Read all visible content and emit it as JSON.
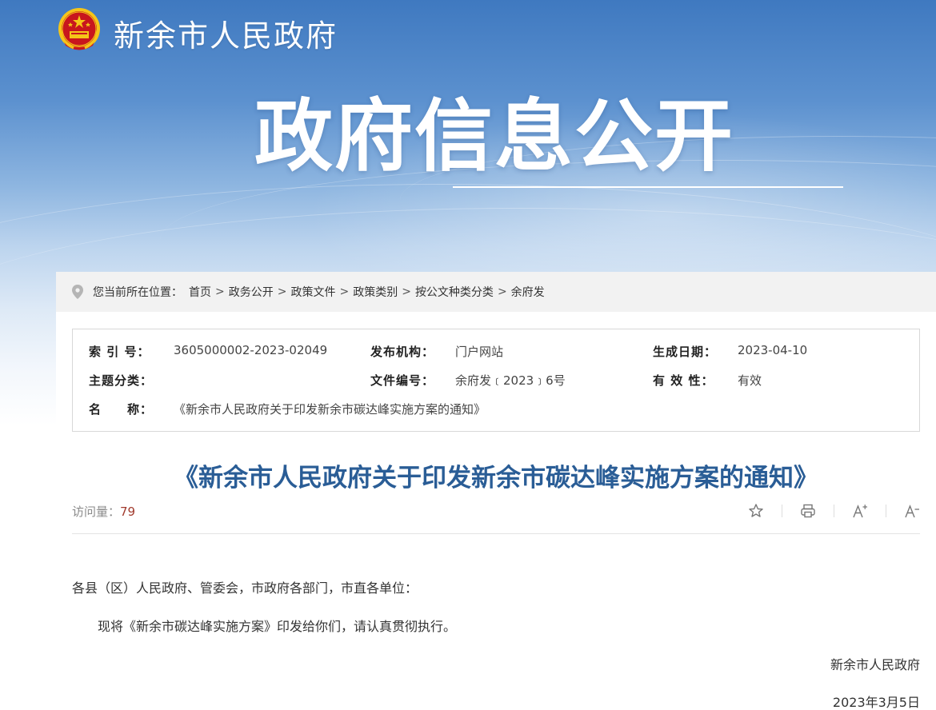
{
  "header": {
    "site_title": "新余市人民政府",
    "hero_title": "政府信息公开"
  },
  "breadcrumb": {
    "prefix": "您当前所在位置：",
    "items": [
      "首页",
      "政务公开",
      "政策文件",
      "政策类别",
      "按公文种类分类",
      "余府发"
    ],
    "separator": ">"
  },
  "info": {
    "index_label": "索 引 号：",
    "index_value": "3605000002-2023-02049",
    "publisher_label": "发布机构：",
    "publisher_value": "门户网站",
    "date_label": "生成日期：",
    "date_value": "2023-04-10",
    "topic_label": "主题分类：",
    "topic_value": "",
    "docno_label": "文件编号：",
    "docno_value": "余府发﹝2023﹞6号",
    "validity_label": "有 效 性：",
    "validity_value": "有效",
    "name_label": "名　　称：",
    "name_value": "《新余市人民政府关于印发新余市碳达峰实施方案的通知》"
  },
  "document": {
    "title": "《新余市人民政府关于印发新余市碳达峰实施方案的通知》",
    "visits_label": "访问量：",
    "visits_count": "79",
    "salutation": "各县（区）人民政府、管委会，市政府各部门，市直各单位：",
    "paragraph": "现将《新余市碳达峰实施方案》印发给你们，请认真贯彻执行。",
    "signature": "新余市人民政府",
    "sign_date": "2023年3月5日"
  },
  "tools": {
    "font_up": "A+",
    "font_down": "A-"
  },
  "colors": {
    "banner_top": "#3f79c0",
    "title_blue": "#2a5d96",
    "visit_count": "#a13a2d",
    "emblem_red": "#c8161d",
    "emblem_gold": "#f5c518"
  }
}
